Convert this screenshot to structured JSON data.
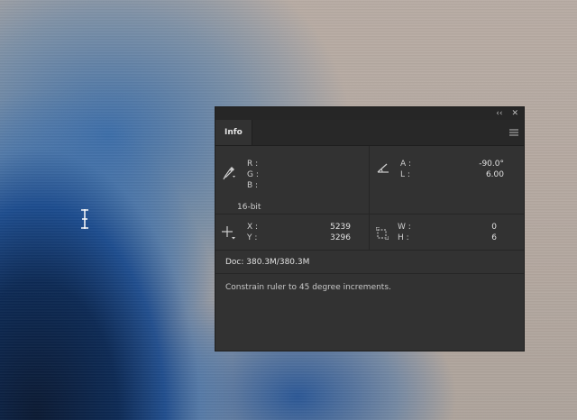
{
  "panel": {
    "title_buttons": {
      "collapse": "‹‹",
      "close": "✕"
    },
    "tab_label": "Info",
    "color": {
      "r_label": "R :",
      "g_label": "G :",
      "b_label": "B :",
      "bit_depth": "16-bit"
    },
    "angle": {
      "a_label": "A :",
      "a_value": "-90.0°",
      "l_label": "L :",
      "l_value": "6.00"
    },
    "position": {
      "x_label": "X :",
      "x_value": "5239",
      "y_label": "Y :",
      "y_value": "3296"
    },
    "size": {
      "w_label": "W :",
      "w_value": "0",
      "h_label": "H :",
      "h_value": "6"
    },
    "doc_info": "Doc: 380.3M/380.3M",
    "hint": "Constrain ruler to 45 degree increments."
  },
  "colors": {
    "panel_bg": "#323232",
    "tab_bar_bg": "#282828",
    "text": "#cfcfcf"
  },
  "icons": {
    "eyedropper": "eyedropper-icon",
    "angle": "angle-icon",
    "crosshair": "crosshair-icon",
    "selection": "selection-size-icon",
    "menu": "panel-menu-icon",
    "cursor": "ruler-cursor-icon"
  }
}
